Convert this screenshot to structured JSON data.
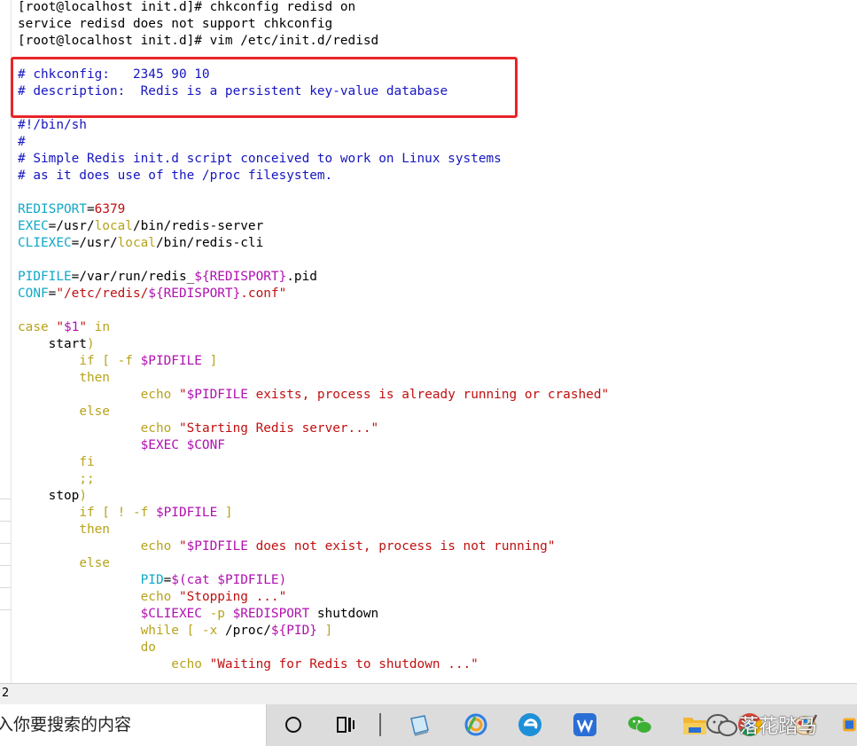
{
  "terminal": {
    "lines": [
      [
        [
          "c-blk",
          "[root@localhost init.d]# chkconfig redisd on"
        ]
      ],
      [
        [
          "c-blk",
          "service redisd does not support chkconfig"
        ]
      ],
      [
        [
          "c-blk",
          "[root@localhost init.d]# vim /etc/init.d/redisd"
        ]
      ],
      [
        [
          "c-blk",
          ""
        ]
      ],
      [
        [
          "c-cmt",
          "# chkconfig:   2345 90 10"
        ]
      ],
      [
        [
          "c-cmt",
          "# description:  Redis is a persistent key-value database"
        ]
      ],
      [
        [
          "c-blk",
          ""
        ]
      ],
      [
        [
          "c-cmt",
          "#!/bin/sh"
        ]
      ],
      [
        [
          "c-cmt",
          "#"
        ]
      ],
      [
        [
          "c-cmt",
          "# Simple Redis init.d script conceived to work on Linux systems"
        ]
      ],
      [
        [
          "c-cmt",
          "# as it does use of the /proc filesystem."
        ]
      ],
      [
        [
          "c-blk",
          ""
        ]
      ],
      [
        [
          "c-var",
          "REDISPORT"
        ],
        [
          "c-blk",
          "="
        ],
        [
          "c-str",
          "6379"
        ]
      ],
      [
        [
          "c-var",
          "EXEC"
        ],
        [
          "c-blk",
          "=/usr/"
        ],
        [
          "c-kw",
          "local"
        ],
        [
          "c-blk",
          "/bin/redis-server"
        ]
      ],
      [
        [
          "c-var",
          "CLIEXEC"
        ],
        [
          "c-blk",
          "=/usr/"
        ],
        [
          "c-kw",
          "local"
        ],
        [
          "c-blk",
          "/bin/redis-cli"
        ]
      ],
      [
        [
          "c-blk",
          ""
        ]
      ],
      [
        [
          "c-var",
          "PIDFILE"
        ],
        [
          "c-blk",
          "=/var/run/redis_"
        ],
        [
          "c-dol",
          "${REDISPORT}"
        ],
        [
          "c-blk",
          ".pid"
        ]
      ],
      [
        [
          "c-var",
          "CONF"
        ],
        [
          "c-blk",
          "="
        ],
        [
          "c-str",
          "\"/etc/redis/"
        ],
        [
          "c-dol",
          "${REDISPORT}"
        ],
        [
          "c-str",
          ".conf\""
        ]
      ],
      [
        [
          "c-blk",
          ""
        ]
      ],
      [
        [
          "c-kw",
          "case"
        ],
        [
          "c-blk",
          " "
        ],
        [
          "c-str",
          "\""
        ],
        [
          "c-dol",
          "$1"
        ],
        [
          "c-str",
          "\""
        ],
        [
          "c-blk",
          " "
        ],
        [
          "c-kw",
          "in"
        ]
      ],
      [
        [
          "c-blk",
          "    start"
        ],
        [
          "c-kw",
          ")"
        ]
      ],
      [
        [
          "c-blk",
          "        "
        ],
        [
          "c-kw",
          "if [ -f "
        ],
        [
          "c-dol",
          "$PIDFILE"
        ],
        [
          "c-kw",
          " ]"
        ]
      ],
      [
        [
          "c-blk",
          "        "
        ],
        [
          "c-kw",
          "then"
        ]
      ],
      [
        [
          "c-blk",
          "                "
        ],
        [
          "c-kw",
          "echo "
        ],
        [
          "c-str",
          "\""
        ],
        [
          "c-dol",
          "$PIDFILE"
        ],
        [
          "c-str",
          " exists, process is already running or crashed\""
        ]
      ],
      [
        [
          "c-blk",
          "        "
        ],
        [
          "c-kw",
          "else"
        ]
      ],
      [
        [
          "c-blk",
          "                "
        ],
        [
          "c-kw",
          "echo "
        ],
        [
          "c-str",
          "\"Starting Redis server...\""
        ]
      ],
      [
        [
          "c-blk",
          "                "
        ],
        [
          "c-dol",
          "$EXEC $CONF"
        ]
      ],
      [
        [
          "c-blk",
          "        "
        ],
        [
          "c-kw",
          "fi"
        ]
      ],
      [
        [
          "c-blk",
          "        "
        ],
        [
          "c-kw",
          ";;"
        ]
      ],
      [
        [
          "c-blk",
          "    stop"
        ],
        [
          "c-kw",
          ")"
        ]
      ],
      [
        [
          "c-blk",
          "        "
        ],
        [
          "c-kw",
          "if [ ! -f "
        ],
        [
          "c-dol",
          "$PIDFILE"
        ],
        [
          "c-kw",
          " ]"
        ]
      ],
      [
        [
          "c-blk",
          "        "
        ],
        [
          "c-kw",
          "then"
        ]
      ],
      [
        [
          "c-blk",
          "                "
        ],
        [
          "c-kw",
          "echo "
        ],
        [
          "c-str",
          "\""
        ],
        [
          "c-dol",
          "$PIDFILE"
        ],
        [
          "c-str",
          " does not exist, process is not running\""
        ]
      ],
      [
        [
          "c-blk",
          "        "
        ],
        [
          "c-kw",
          "else"
        ]
      ],
      [
        [
          "c-blk",
          "                "
        ],
        [
          "c-var",
          "PID"
        ],
        [
          "c-blk",
          "="
        ],
        [
          "c-dol",
          "$(cat $PIDFILE)"
        ]
      ],
      [
        [
          "c-blk",
          "                "
        ],
        [
          "c-kw",
          "echo "
        ],
        [
          "c-str",
          "\"Stopping ...\""
        ]
      ],
      [
        [
          "c-blk",
          "                "
        ],
        [
          "c-dol",
          "$CLIEXEC"
        ],
        [
          "c-kw",
          " -p "
        ],
        [
          "c-dol",
          "$REDISPORT"
        ],
        [
          "c-blk",
          " shutdown"
        ]
      ],
      [
        [
          "c-blk",
          "                "
        ],
        [
          "c-kw",
          "while [ -x "
        ],
        [
          "c-blk",
          "/proc/"
        ],
        [
          "c-dol",
          "${PID}"
        ],
        [
          "c-kw",
          " ]"
        ]
      ],
      [
        [
          "c-blk",
          "                "
        ],
        [
          "c-kw",
          "do"
        ]
      ],
      [
        [
          "c-blk",
          "                    "
        ],
        [
          "c-kw",
          "echo "
        ],
        [
          "c-str",
          "\"Waiting for Redis to shutdown ...\""
        ]
      ]
    ]
  },
  "statusbar": {
    "text": "2"
  },
  "taskbar": {
    "search_placeholder": "入你要搜索的内容",
    "icons": [
      "cortana-icon",
      "task-view-icon",
      "notepad-icon",
      "browser-icon",
      "ie-icon",
      "wps-icon",
      "wechat-icon",
      "file-explorer-icon",
      "chrome-icon",
      "paint-icon",
      "app-icon"
    ]
  },
  "watermark": {
    "text": "落花踏马"
  }
}
